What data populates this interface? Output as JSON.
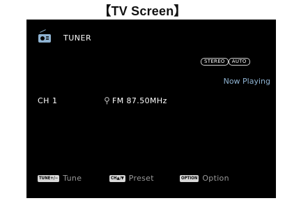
{
  "caption": "【TV Screen】",
  "header": {
    "source_icon": "radio-icon",
    "source_name": "TUNER"
  },
  "badges": [
    "STEREO",
    "AUTO"
  ],
  "status": "Now Playing",
  "station": {
    "channel": "CH 1",
    "band_icon": "pin-icon",
    "frequency": "FM 87.50MHz"
  },
  "hints": [
    {
      "key": "TUNE+/−",
      "label": "Tune"
    },
    {
      "key": "CH▲/▼",
      "label": "Preset"
    },
    {
      "key": "OPTION",
      "label": "Option"
    }
  ],
  "colors": {
    "screen_bg": "#000000",
    "accent": "#8fb3d2",
    "hint_text": "#9a9a9a"
  }
}
